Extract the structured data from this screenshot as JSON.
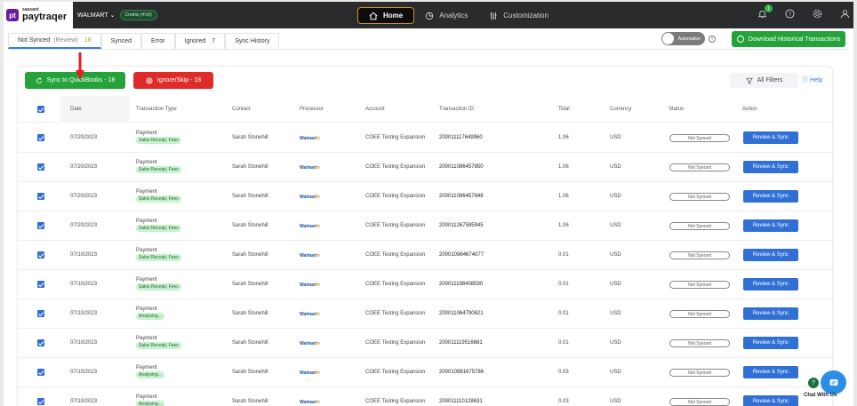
{
  "header": {
    "logo_small": "saasant",
    "logo_big": "paytraqer",
    "logo_mark": "pt",
    "company": "WALMART",
    "credits": "Credits (4½0)",
    "nav": [
      {
        "label": "Home",
        "icon": "home-icon",
        "active": true
      },
      {
        "label": "Analytics",
        "icon": "analytics-icon",
        "active": false
      },
      {
        "label": "Customization",
        "icon": "customization-icon",
        "active": false
      }
    ],
    "notifications_count": "1"
  },
  "tabs": [
    {
      "label": "Not Synced",
      "sub": "(Review)",
      "count": "18",
      "active": true
    },
    {
      "label": "Synced",
      "sub": "",
      "count": "",
      "active": false
    },
    {
      "label": "Error",
      "sub": "",
      "count": "",
      "active": false
    },
    {
      "label": "Ignored",
      "sub": "",
      "count": "7",
      "active": false
    },
    {
      "label": "Sync History",
      "sub": "",
      "count": "",
      "active": false
    }
  ],
  "automation_label": "Automation",
  "download_label": "Download Historical Transactions",
  "toolbar": {
    "sync_label": "Sync to QuickBooks - 18",
    "ignore_label": "Ignore/Skip - 18",
    "filters_label": "All Filters",
    "help_label": "Help"
  },
  "columns": [
    "Date",
    "Transaction Type",
    "Contact",
    "Processor",
    "Account",
    "Transaction ID",
    "Total",
    "Currency",
    "Status",
    "Action"
  ],
  "rows": [
    {
      "date": "07/20/2023",
      "type": "Payment",
      "tag": "Sales Receipt, Fees",
      "contact": "Sarah Stonehill",
      "processor": "Walmart",
      "account": "COEE Testing Expansion",
      "txn_id": "200011117649960",
      "total": "1.06",
      "currency": "USD",
      "status": "Not Synced",
      "action": "Review & Sync"
    },
    {
      "date": "07/20/2023",
      "type": "Payment",
      "tag": "Sales Receipt, Fees",
      "contact": "Sarah Stonehill",
      "processor": "Walmart",
      "account": "COEE Testing Expansion",
      "txn_id": "200011086457850",
      "total": "1.06",
      "currency": "USD",
      "status": "Not Synced",
      "action": "Review & Sync"
    },
    {
      "date": "07/20/2023",
      "type": "Payment",
      "tag": "Sales Receipt, Fees",
      "contact": "Sarah Stonehill",
      "processor": "Walmart",
      "account": "COEE Testing Expansion",
      "txn_id": "200011086457848",
      "total": "1.06",
      "currency": "USD",
      "status": "Not Synced",
      "action": "Review & Sync"
    },
    {
      "date": "07/20/2023",
      "type": "Payment",
      "tag": "Sales Receipt, Fees",
      "contact": "Sarah Stonehill",
      "processor": "Walmart",
      "account": "COEE Testing Expansion",
      "txn_id": "200011267595945",
      "total": "1.06",
      "currency": "USD",
      "status": "Not Synced",
      "action": "Review & Sync"
    },
    {
      "date": "07/10/2023",
      "type": "Payment",
      "tag": "Sales Receipt, Fees",
      "contact": "Sarah Stonehill",
      "processor": "Walmart",
      "account": "COEE Testing Expansion",
      "txn_id": "200010984674077",
      "total": "0.01",
      "currency": "USD",
      "status": "Not Synced",
      "action": "Review & Sync"
    },
    {
      "date": "07/10/2023",
      "type": "Payment",
      "tag": "Sales Receipt, Fees",
      "contact": "Sarah Stonehill",
      "processor": "Walmart",
      "account": "COEE Testing Expansion",
      "txn_id": "200011198408590",
      "total": "0.01",
      "currency": "USD",
      "status": "Not Synced",
      "action": "Review & Sync"
    },
    {
      "date": "07/10/2023",
      "type": "Payment",
      "tag": "Analysing...",
      "contact": "Sarah Stonehill",
      "processor": "Walmart",
      "account": "COEE Testing Expansion",
      "txn_id": "200011064790621",
      "total": "0.01",
      "currency": "USD",
      "status": "Not Synced",
      "action": "Review & Sync"
    },
    {
      "date": "07/10/2023",
      "type": "Payment",
      "tag": "Sales Receipt, Fees",
      "contact": "Sarah Stonehill",
      "processor": "Walmart",
      "account": "COEE Testing Expansion",
      "txn_id": "200011119516681",
      "total": "0.01",
      "currency": "USD",
      "status": "Not Synced",
      "action": "Review & Sync"
    },
    {
      "date": "07/10/2023",
      "type": "Payment",
      "tag": "Analysing...",
      "contact": "Sarah Stonehill",
      "processor": "Walmart",
      "account": "COEE Testing Expansion",
      "txn_id": "200010981675786",
      "total": "0.03",
      "currency": "USD",
      "status": "Not Synced",
      "action": "Review & Sync"
    },
    {
      "date": "07/10/2023",
      "type": "Payment",
      "tag": "Analysing...",
      "contact": "Sarah Stonehill",
      "processor": "Walmart",
      "account": "COEE Testing Expansion",
      "txn_id": "200011110128631",
      "total": "0.03",
      "currency": "USD",
      "status": "Not Synced",
      "action": "Review & Sync"
    }
  ],
  "chat_label": "Chat With Us",
  "colors": {
    "accent": "#2f6fd6",
    "success": "#23a33a",
    "danger": "#e02b2b",
    "header": "#2a2b2d"
  }
}
